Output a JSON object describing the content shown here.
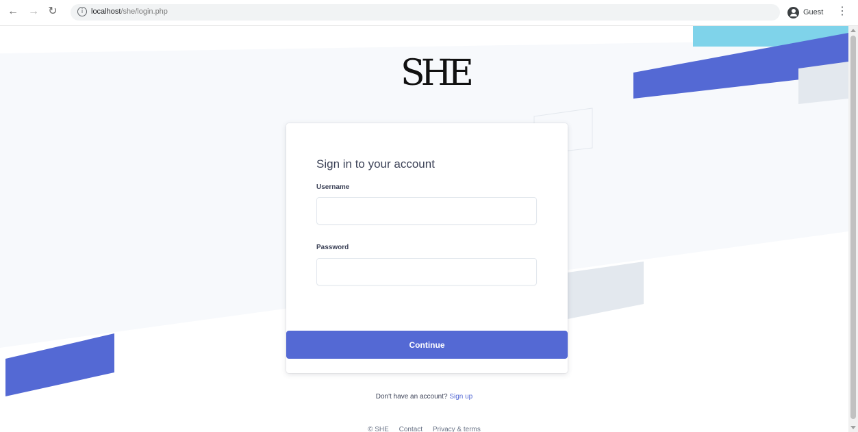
{
  "browser": {
    "back_icon": "arrow-left-icon",
    "forward_icon": "arrow-right-icon",
    "reload_icon": "reload-icon",
    "url_host": "localhost",
    "url_path": "/she/login.php",
    "profile_label": "Guest",
    "menu_icon": "kebab-menu-icon"
  },
  "logo": {
    "text": "SHE"
  },
  "login": {
    "title": "Sign in to your account",
    "username_label": "Username",
    "username_value": "",
    "password_label": "Password",
    "password_value": "",
    "continue_label": "Continue"
  },
  "signup": {
    "prompt": "Don't have an account?",
    "link": "Sign up"
  },
  "footer": {
    "copyright": "© SHE",
    "contact": "Contact",
    "privacy": "Privacy & terms"
  },
  "colors": {
    "accent": "#5469d4",
    "cyan": "#7fd3ea",
    "gray_band": "#e3e8ee"
  }
}
